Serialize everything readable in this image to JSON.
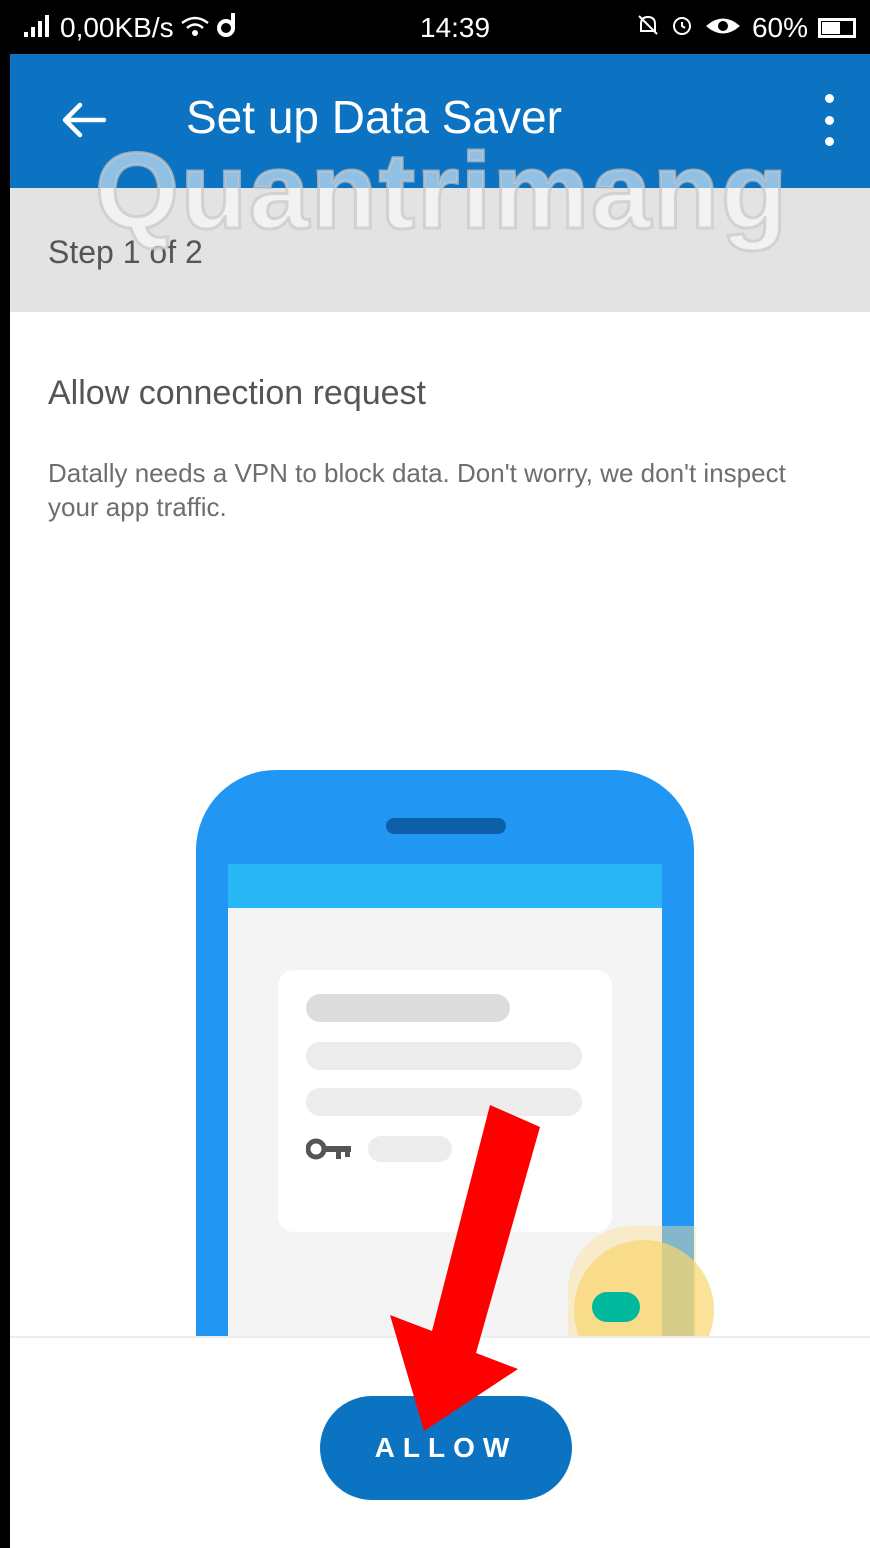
{
  "status_bar": {
    "network_speed": "0,00KB/s",
    "time": "14:39",
    "battery_percent": "60%",
    "battery_level": 0.6
  },
  "app_bar": {
    "title": "Set up Data Saver"
  },
  "step": {
    "label": "Step 1 of 2"
  },
  "watermark": {
    "text": "Quantrimang"
  },
  "content": {
    "title": "Allow connection request",
    "description": "Datally needs a VPN to block data. Don't worry, we don't inspect your app traffic."
  },
  "actions": {
    "allow_label": "ALLOW"
  },
  "colors": {
    "primary": "#0b73c2",
    "phone_body": "#2196f3",
    "phone_bar": "#29b6f6",
    "toggle": "#00b89c",
    "arrow": "#ff0000"
  }
}
